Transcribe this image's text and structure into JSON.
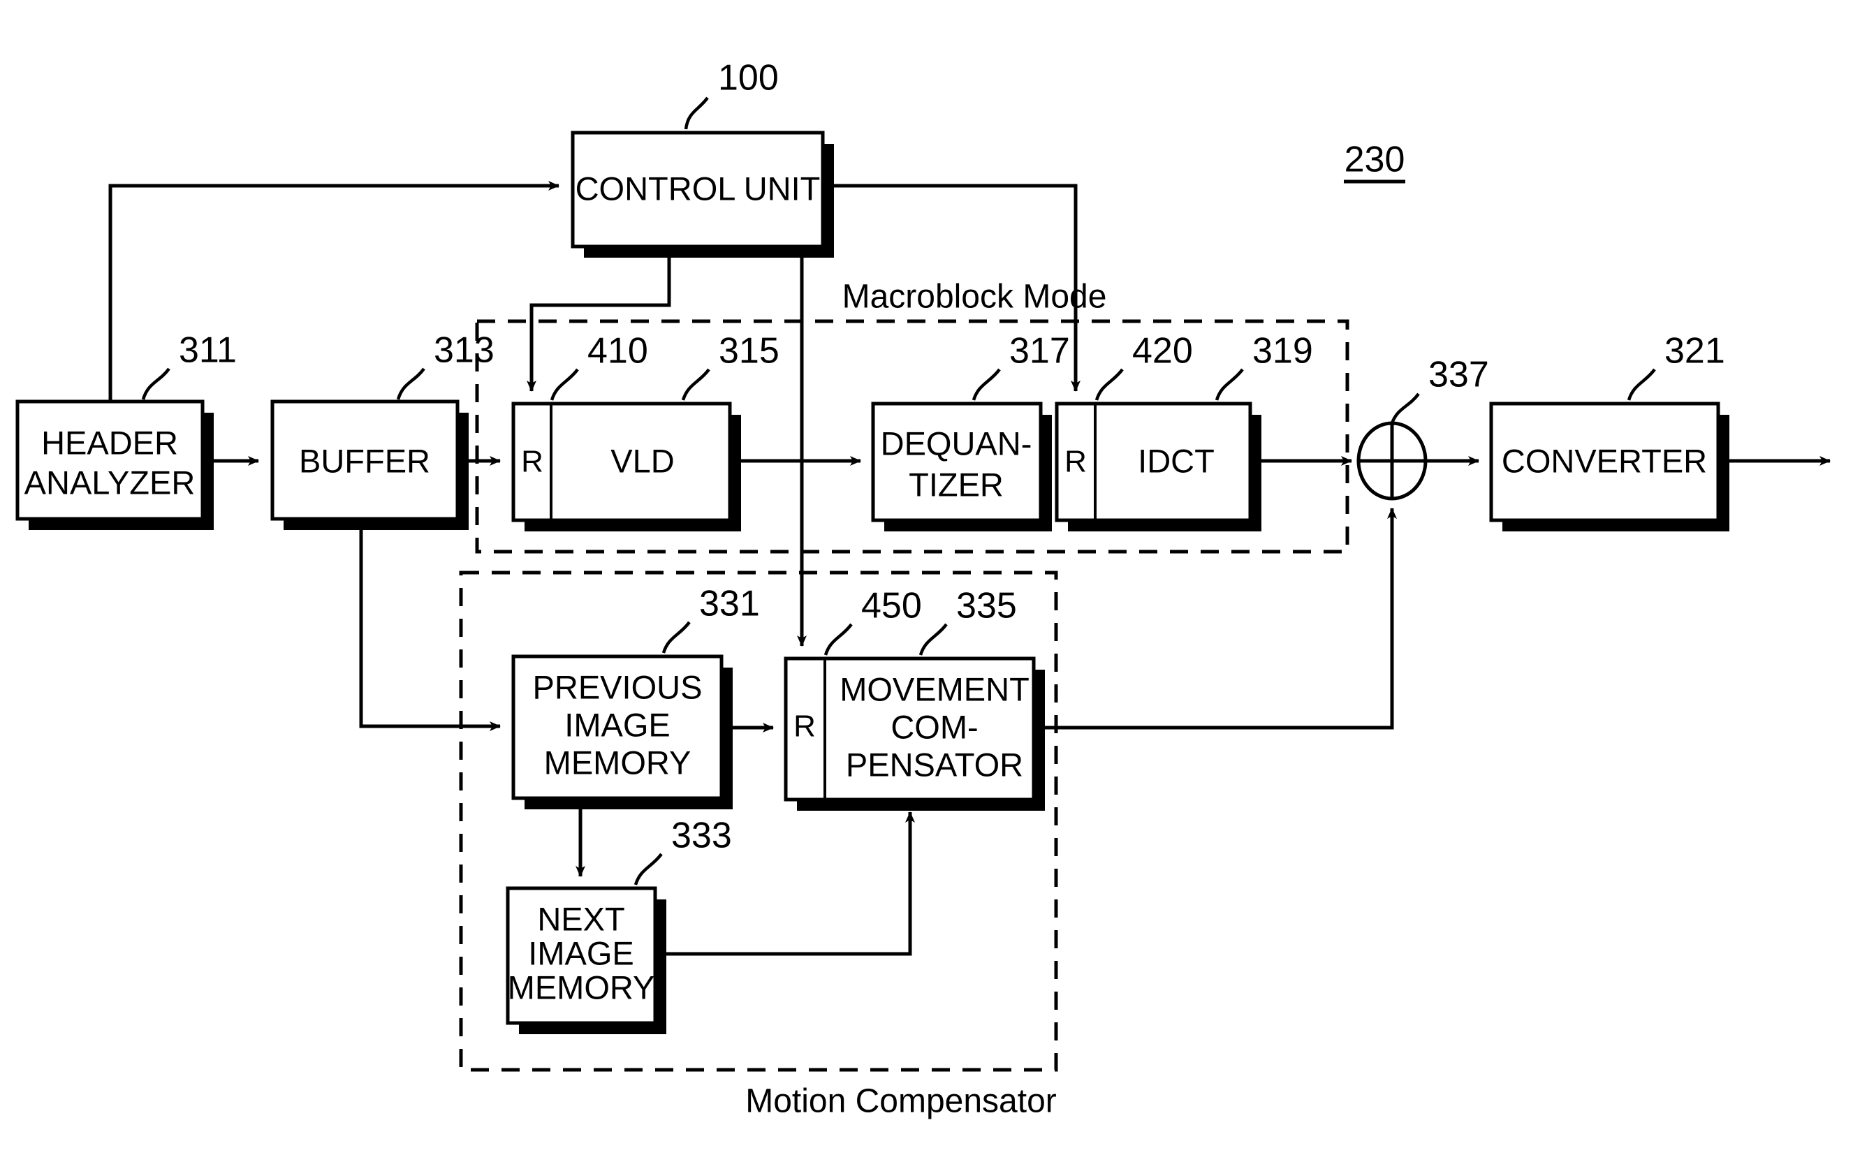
{
  "figure": {
    "reference": "230",
    "groups": [
      {
        "id": "macroblock",
        "label": "Macroblock Mode"
      },
      {
        "id": "motion",
        "label": "Motion Compensator"
      }
    ]
  },
  "blocks": [
    {
      "id": "header-analyzer",
      "ref": "311",
      "lines": [
        "HEADER",
        "ANALYZER"
      ]
    },
    {
      "id": "buffer",
      "ref": "313",
      "lines": [
        "BUFFER"
      ]
    },
    {
      "id": "vld",
      "ref": "315",
      "sub_ref": "410",
      "sub_label": "R",
      "lines": [
        "VLD"
      ]
    },
    {
      "id": "dequantizer",
      "ref": "317",
      "lines": [
        "DEQUAN-",
        "TIZER"
      ]
    },
    {
      "id": "idct",
      "ref": "319",
      "sub_ref": "420",
      "sub_label": "R",
      "lines": [
        "IDCT"
      ]
    },
    {
      "id": "converter",
      "ref": "321",
      "lines": [
        "CONVERTER"
      ]
    },
    {
      "id": "control-unit",
      "ref": "100",
      "lines": [
        "CONTROL UNIT"
      ]
    },
    {
      "id": "previous-image-memory",
      "ref": "331",
      "lines": [
        "PREVIOUS",
        "IMAGE",
        "MEMORY"
      ]
    },
    {
      "id": "next-image-memory",
      "ref": "333",
      "lines": [
        "NEXT",
        "IMAGE",
        "MEMORY"
      ]
    },
    {
      "id": "movement-compensator",
      "ref": "335",
      "sub_ref": "450",
      "sub_label": "R",
      "lines": [
        "MOVEMENT",
        "COM-",
        "PENSATOR"
      ]
    },
    {
      "id": "adder",
      "ref": "337",
      "lines": []
    }
  ],
  "labels": {
    "header_l1": "HEADER",
    "header_l2": "ANALYZER",
    "buffer": "BUFFER",
    "vld": "VLD",
    "vld_r": "R",
    "dequant_l1": "DEQUAN-",
    "dequant_l2": "TIZER",
    "idct": "IDCT",
    "idct_r": "R",
    "converter": "CONVERTER",
    "control_unit": "CONTROL UNIT",
    "prev_l1": "PREVIOUS",
    "prev_l2": "IMAGE",
    "prev_l3": "MEMORY",
    "next_l1": "NEXT",
    "next_l2": "IMAGE",
    "next_l3": "MEMORY",
    "mc_l1": "MOVEMENT",
    "mc_l2": "COM-",
    "mc_l3": "PENSATOR",
    "mc_r": "R",
    "macroblock_mode": "Macroblock Mode",
    "motion_compensator": "Motion Compensator",
    "fig_ref": "230"
  },
  "refs": {
    "n100": "100",
    "n311": "311",
    "n313": "313",
    "n410": "410",
    "n315": "315",
    "n317": "317",
    "n420": "420",
    "n319": "319",
    "n337": "337",
    "n321": "321",
    "n331": "331",
    "n450": "450",
    "n335": "335",
    "n333": "333"
  },
  "colors": {
    "ink": "#000000",
    "paper": "#ffffff"
  }
}
